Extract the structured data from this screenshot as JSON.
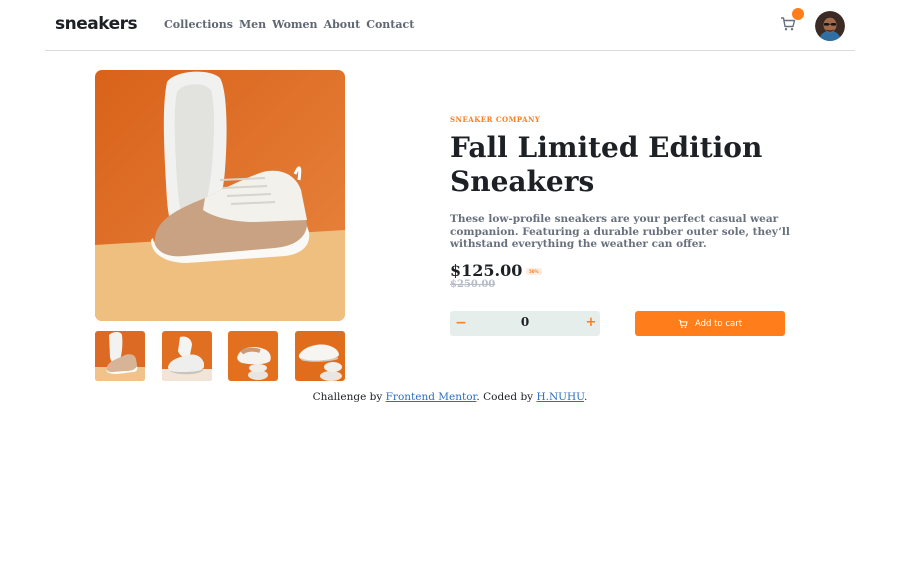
{
  "header": {
    "logo": "sneakers",
    "nav": [
      "Collections",
      "Men",
      "Women",
      "About",
      "Contact"
    ],
    "cart_icon": "cart-icon",
    "avatar_icon": "avatar"
  },
  "product": {
    "company": "SNEAKER COMPANY",
    "title": "Fall Limited Edition Sneakers",
    "description": "These low-profile sneakers are your perfect casual wear companion. Featuring a durable rubber outer sole, they’ll withstand everything the weather can offer.",
    "price": "$125.00",
    "discount": "50%",
    "old_price": "$250.00",
    "quantity": "0",
    "minus_label": "−",
    "plus_label": "+",
    "add_to_cart": "Add to cart"
  },
  "footer": {
    "prefix": "Challenge by ",
    "link1": "Frontend Mentor",
    "middle": ". Coded by ",
    "link2": "H.NUHU",
    "suffix": "."
  },
  "colors": {
    "accent": "#ff7d1a",
    "accent_pale": "#ffede0",
    "dark": "#1d2025",
    "muted": "#68707d",
    "qty_bg": "#e6eeec"
  }
}
